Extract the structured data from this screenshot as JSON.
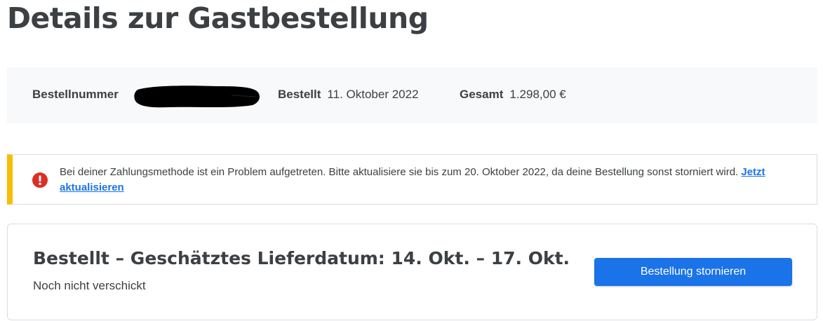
{
  "page": {
    "title": "Details zur Gastbestellung"
  },
  "order_summary": {
    "order_number_label": "Bestellnummer",
    "order_number_value": "",
    "ordered_label": "Bestellt",
    "ordered_value": "11. Oktober 2022",
    "total_label": "Gesamt",
    "total_value": "1.298,00 €"
  },
  "alert": {
    "message": "Bei deiner Zahlungsmethode ist ein Problem aufgetreten. Bitte aktualisiere sie bis zum 20. Oktober 2022, da deine Bestellung sonst storniert wird.",
    "link_label": "Jetzt aktualisieren",
    "icon": "error-icon",
    "accent_color": "#fbbc04",
    "icon_color": "#d93025"
  },
  "status_card": {
    "title": "Bestellt – Geschätztes Lieferdatum: 14. Okt. – 17. Okt.",
    "subtitle": "Noch nicht verschickt",
    "cancel_button_label": "Bestellung stornieren",
    "button_color": "#1a73e8"
  }
}
